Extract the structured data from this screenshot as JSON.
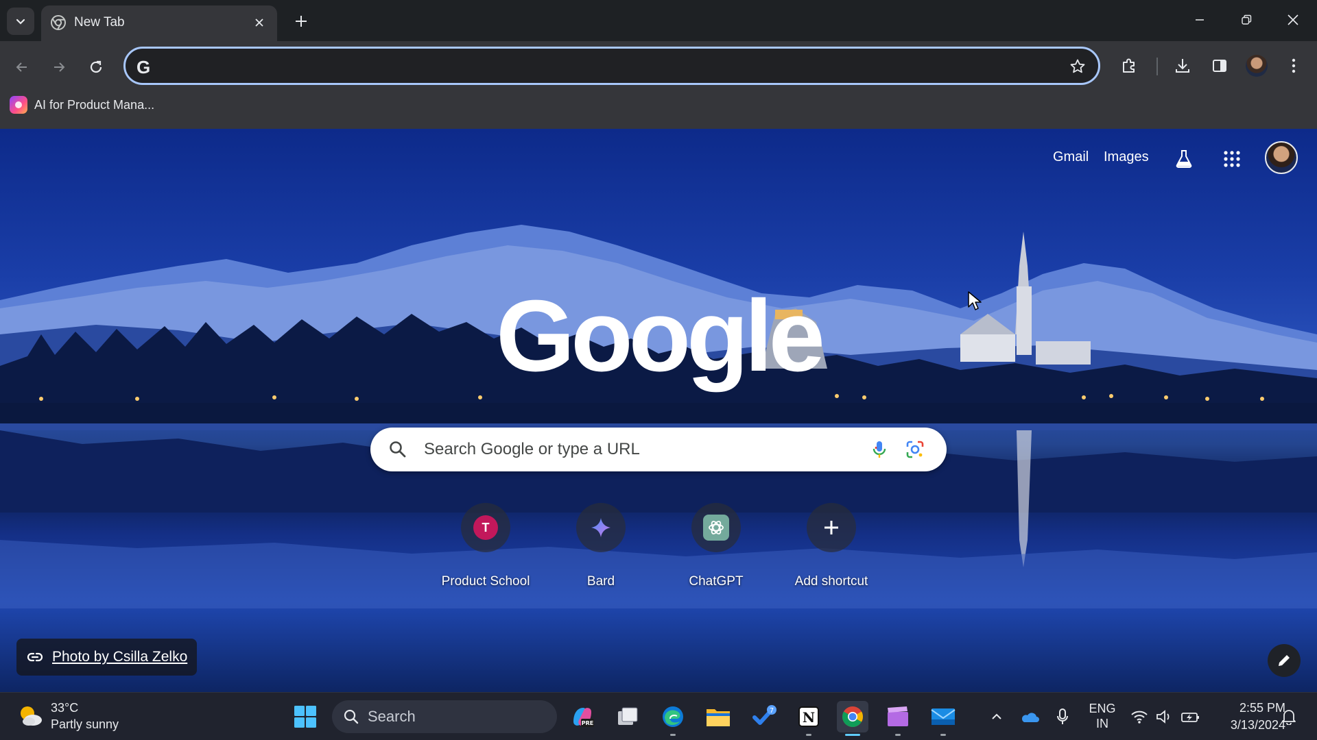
{
  "browser": {
    "tab": {
      "title": "New Tab"
    },
    "omnibox": {
      "value": "",
      "placeholder": ""
    },
    "bookmarks": [
      {
        "label": "AI for Product Mana..."
      }
    ]
  },
  "ntp": {
    "header_links": {
      "gmail": "Gmail",
      "images": "Images"
    },
    "logo_text": "Google",
    "search": {
      "placeholder": "Search Google or type a URL"
    },
    "shortcuts": [
      {
        "label": "Product School",
        "icon": "T"
      },
      {
        "label": "Bard",
        "icon": "bard-icon"
      },
      {
        "label": "ChatGPT",
        "icon": "chatgpt-icon"
      },
      {
        "label": "Add shortcut",
        "icon": "plus-icon"
      }
    ],
    "attribution": "Photo by Csilla Zelko"
  },
  "taskbar": {
    "weather": {
      "temperature": "33°C",
      "condition": "Partly sunny"
    },
    "search_label": "Search",
    "language": {
      "line1": "ENG",
      "line2": "IN"
    },
    "clock": {
      "time": "2:55 PM",
      "date": "3/13/2024"
    },
    "pinned_apps": [
      "windows-start-icon",
      "search",
      "copilot-pre-icon",
      "task-view-icon",
      "edge-icon",
      "file-explorer-icon",
      "todo-icon",
      "notion-icon",
      "chrome-icon",
      "clapper-icon",
      "mail-app-icon"
    ]
  },
  "colors": {
    "omnibox_focus": "#a8c7fa",
    "product_school_badge": "#c2185b",
    "taskbar_active": "#60cdff"
  }
}
